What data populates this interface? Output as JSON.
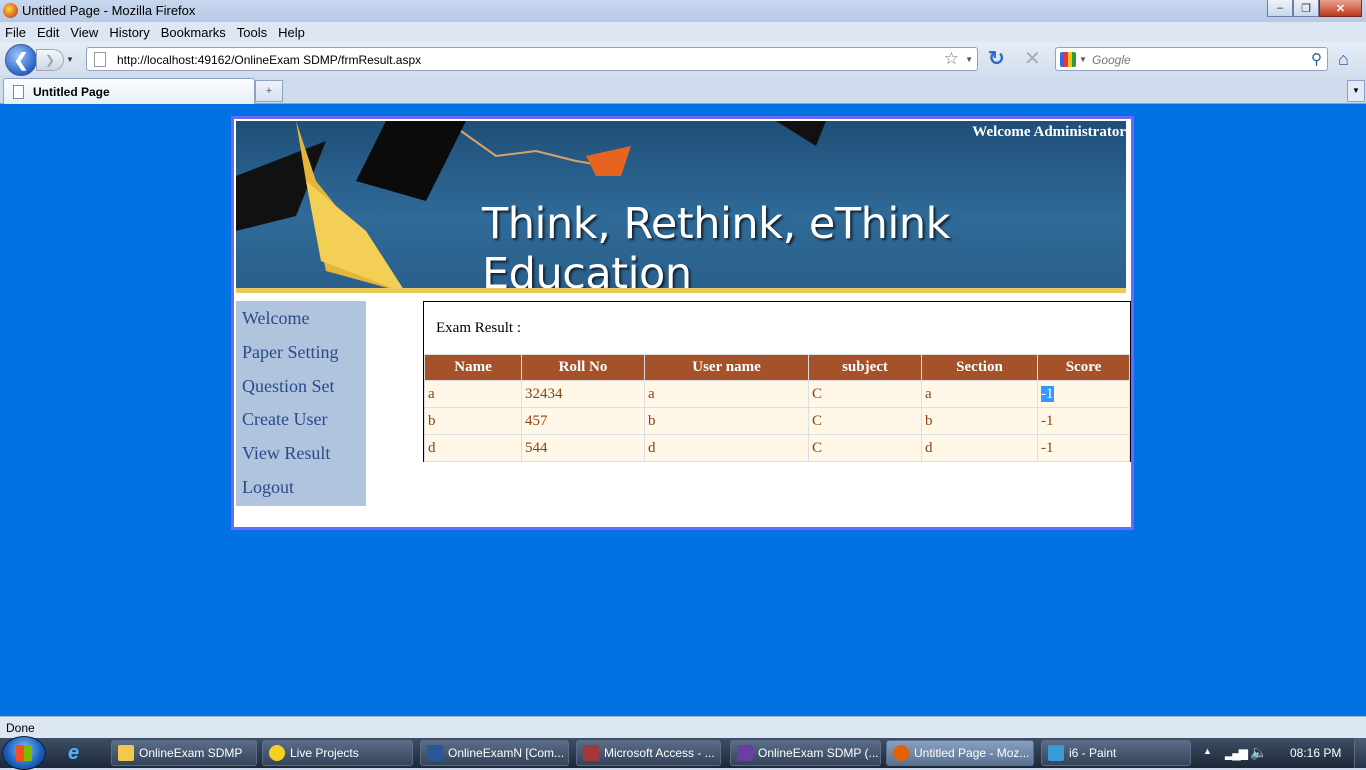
{
  "window": {
    "title": "Untitled Page - Mozilla Firefox",
    "controls": [
      "–",
      "❐",
      "✕"
    ]
  },
  "menu": [
    "File",
    "Edit",
    "View",
    "History",
    "Bookmarks",
    "Tools",
    "Help"
  ],
  "nav": {
    "url": "http://localhost:49162/OnlineExam SDMP/frmResult.aspx",
    "search_placeholder": "Google"
  },
  "tabs": [
    {
      "label": "Untitled Page"
    }
  ],
  "page": {
    "welcome": "Welcome Administrator",
    "slogan": "Think, Rethink, eThink Education",
    "menu": [
      "Welcome",
      "Paper Setting",
      "Question Set",
      "Create User",
      "View Result",
      "Logout"
    ],
    "result_caption": "Exam Result :",
    "table": {
      "headers": [
        "Name",
        "Roll No",
        "User name",
        "subject",
        "Section",
        "Score"
      ],
      "rows": [
        [
          "a",
          "32434",
          "a",
          "C",
          "a",
          "-1"
        ],
        [
          "b",
          "457",
          "b",
          "C",
          "b",
          "-1"
        ],
        [
          "d",
          "544",
          "d",
          "C",
          "d",
          "-1"
        ]
      ]
    }
  },
  "status": "Done",
  "taskbar": {
    "items": [
      {
        "label": "OnlineExam SDMP",
        "icon": "folder-icon",
        "color": "#f2c94c"
      },
      {
        "label": "Live Projects",
        "icon": "star-icon",
        "color": "#f5d020"
      },
      {
        "label": "OnlineExamN [Com...",
        "icon": "word-icon",
        "color": "#2b5797"
      },
      {
        "label": "Microsoft Access - ...",
        "icon": "access-icon",
        "color": "#a4373a"
      },
      {
        "label": "OnlineExam SDMP (...",
        "icon": "visual-studio-icon",
        "color": "#6a3fa0"
      },
      {
        "label": "Untitled Page - Moz...",
        "icon": "firefox-icon",
        "color": "#e66000"
      },
      {
        "label": "i6 - Paint",
        "icon": "paint-icon",
        "color": "#3a9ad9"
      }
    ],
    "clock": "08:16 PM"
  },
  "colors": {
    "page_bg": "#0072e3",
    "header_bg": "#a55129",
    "row_bg": "#fff7e7",
    "row_text": "#8c4510",
    "menu_bg": "#b0c4de",
    "frame_border": "#6a6af7"
  }
}
